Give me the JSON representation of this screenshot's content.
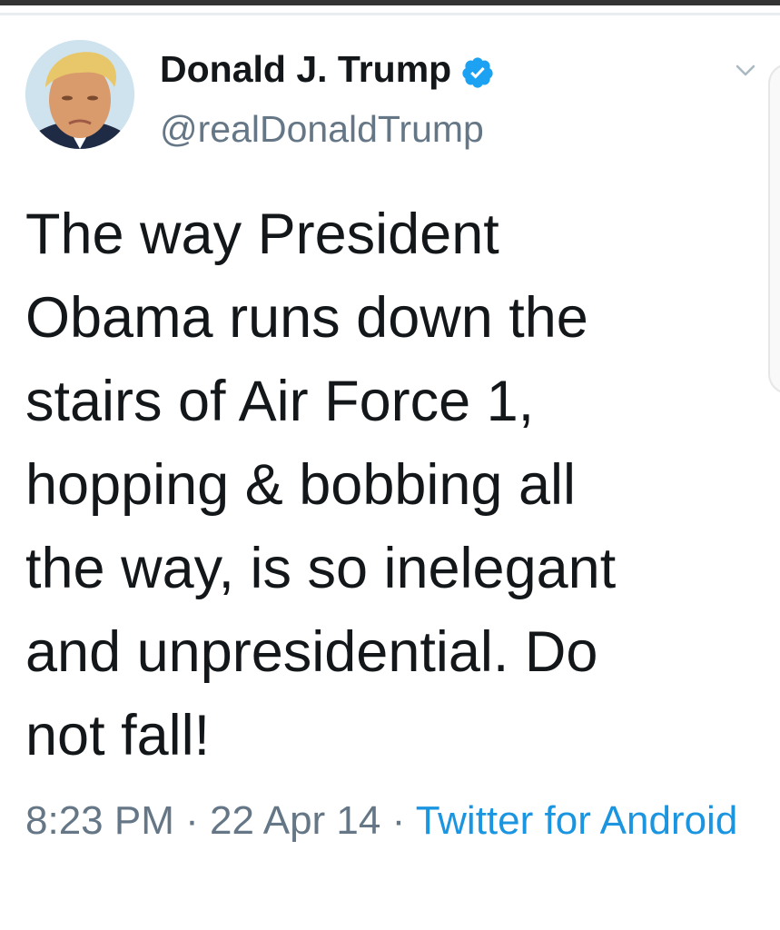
{
  "author": {
    "display_name": "Donald J. Trump",
    "handle": "@realDonaldTrump",
    "verified": true,
    "avatar_icon": "profile-avatar"
  },
  "tweet": {
    "text": "The way President\nObama runs down the\nstairs of Air Force 1,\nhopping & bobbing all\nthe way, is so inelegant\nand unpresidential. Do\nnot fall!",
    "time": "8:23 PM",
    "separator": "·",
    "date": "22 Apr 14",
    "source": "Twitter for Android"
  },
  "icons": {
    "caret": "chevron-down-icon",
    "verified": "verified-badge-icon"
  },
  "colors": {
    "text": "#14171a",
    "secondary": "#657786",
    "link": "#1b95e0",
    "verified": "#1da1f2"
  }
}
